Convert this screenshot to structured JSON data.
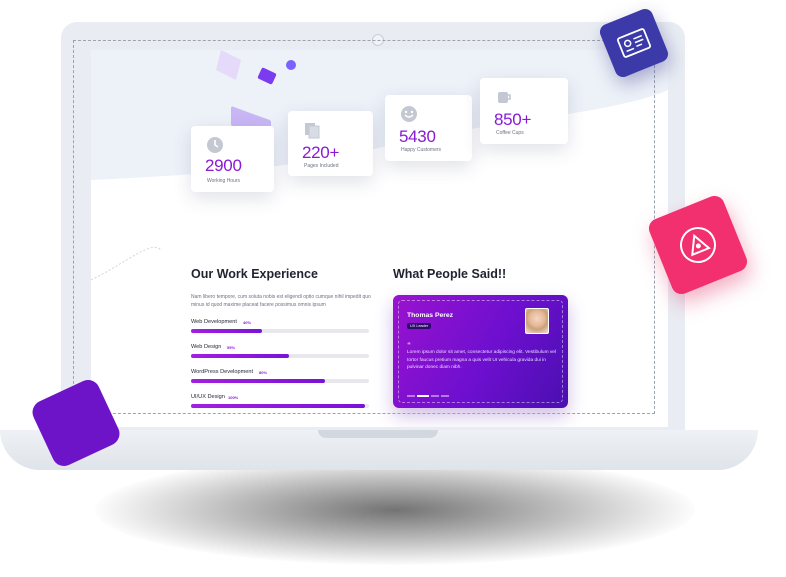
{
  "stats": [
    {
      "icon": "clock-icon",
      "value": "2900",
      "label": "Working Hours"
    },
    {
      "icon": "pages-icon",
      "value": "220+",
      "label": "Pages Included"
    },
    {
      "icon": "smile-icon",
      "value": "5430",
      "label": "Happy Customers"
    },
    {
      "icon": "coffee-cup-icon",
      "value": "850+",
      "label": "Coffee Cups"
    }
  ],
  "experience": {
    "title": "Our Work  Experience",
    "text": "Nam libero tempore, cum soluta nobis est eligendi optio cumque nihil impedit quo minus id quod maxime placeat facere possimus omnis ipsum",
    "skills": [
      {
        "name": "Web Development",
        "percent_label": "40%",
        "level": 0.4
      },
      {
        "name": "Web Design",
        "percent_label": "55%",
        "level": 0.55
      },
      {
        "name": "WordPress Development",
        "percent_label": "80%",
        "level": 0.75
      },
      {
        "name": "UI/UX Design",
        "percent_label": "100%",
        "level": 0.98
      }
    ]
  },
  "testimonials": {
    "title": "What People Said!!",
    "name": "Thomas Perez",
    "role": "UX Leader",
    "text": "Lorem ipsum dolor sit amet, consectetur adipiscing elit. Vestibulum vel tortor faucus pretium magna a quis velit UI vehicula gravida dui in pulvinar donec diam nibh.",
    "slides": 4,
    "active_slide": 1
  },
  "colors": {
    "accent": "#8a19d6",
    "floating_blue": "#3c3aa8",
    "floating_pink": "#f2306f"
  },
  "icons": {
    "floating_blue": "id-card-icon",
    "floating_pink": "triangle-badge-icon"
  }
}
